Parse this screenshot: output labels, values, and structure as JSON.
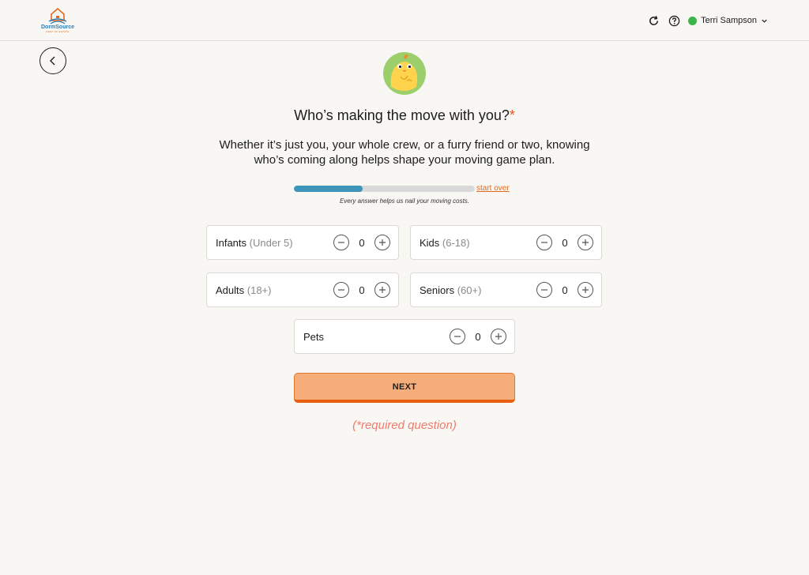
{
  "header": {
    "brand": "DormSource",
    "tagline": "REST OF ESTATE",
    "user_name": "Terri Sampson"
  },
  "question": {
    "text": "Who’s making the move with you?",
    "required_mark": "*"
  },
  "subtitle": "Whether it’s just you, your whole crew, or a furry friend or two, knowing who’s coming along helps shape your moving game plan.",
  "progress": {
    "fraction": 0.38,
    "start_over": "start over",
    "note": "Every answer helps us nail your moving costs."
  },
  "counters": {
    "infants": {
      "label": "Infants",
      "sub": "(Under 5)",
      "value": "0"
    },
    "kids": {
      "label": "Kids",
      "sub": "(6-18)",
      "value": "0"
    },
    "adults": {
      "label": "Adults",
      "sub": "(18+)",
      "value": "0"
    },
    "seniors": {
      "label": "Seniors",
      "sub": "(60+)",
      "value": "0"
    },
    "pets": {
      "label": "Pets",
      "sub": "",
      "value": "0"
    }
  },
  "next_label": "NEXT",
  "required_note": "(*required question)",
  "colors": {
    "accent_orange": "#e8600f",
    "progress_blue": "#3e95b9",
    "status_green": "#3bb54a",
    "button_fill": "#f5ad7a"
  },
  "icons": {
    "refresh": "refresh-icon",
    "help": "help-icon",
    "chevron": "chevron-down-icon",
    "back": "chevron-left-icon",
    "minus": "minus-icon",
    "plus": "plus-icon"
  }
}
